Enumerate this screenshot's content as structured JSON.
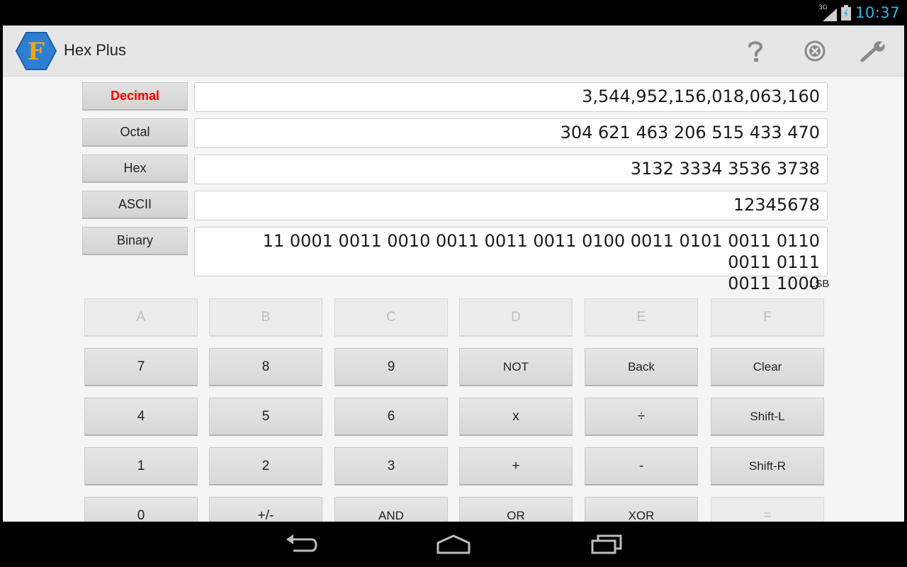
{
  "status_bar": {
    "network": "3G",
    "time": "10:37"
  },
  "app": {
    "title": "Hex Plus",
    "logo_letter": "F"
  },
  "action_icons": [
    "help-icon",
    "close-circle-icon",
    "wrench-icon"
  ],
  "conversions": [
    {
      "label": "Decimal",
      "value": "3,544,952,156,018,063,160",
      "active": true
    },
    {
      "label": "Octal",
      "value": "304 621 463 206 515 433 470",
      "active": false
    },
    {
      "label": "Hex",
      "value": "3132 3334 3536 3738",
      "active": false
    },
    {
      "label": "ASCII",
      "value": "12345678",
      "active": false
    },
    {
      "label": "Binary",
      "value_line1": "11 0001 0011 0010 0011 0011 0011 0100 0011 0101 0011 0110 0011 0111",
      "value_line2": "0011 1000",
      "active": false
    }
  ],
  "bit_order": "LSB",
  "keypad": {
    "row1": [
      "A",
      "B",
      "C",
      "D",
      "E",
      "F"
    ],
    "row2": [
      "7",
      "8",
      "9",
      "NOT",
      "Back",
      "Clear"
    ],
    "row3": [
      "4",
      "5",
      "6",
      "x",
      "÷",
      "Shift-L"
    ],
    "row4": [
      "1",
      "2",
      "3",
      "+",
      "-",
      "Shift-R"
    ],
    "row5": [
      "0",
      "+/-",
      "AND",
      "OR",
      "XOR",
      "="
    ]
  },
  "colors": {
    "active_label": "#ff0000",
    "clock": "#33b5e5",
    "logo_hex": "#2f7fd1",
    "logo_letter": "#f4a21a"
  }
}
